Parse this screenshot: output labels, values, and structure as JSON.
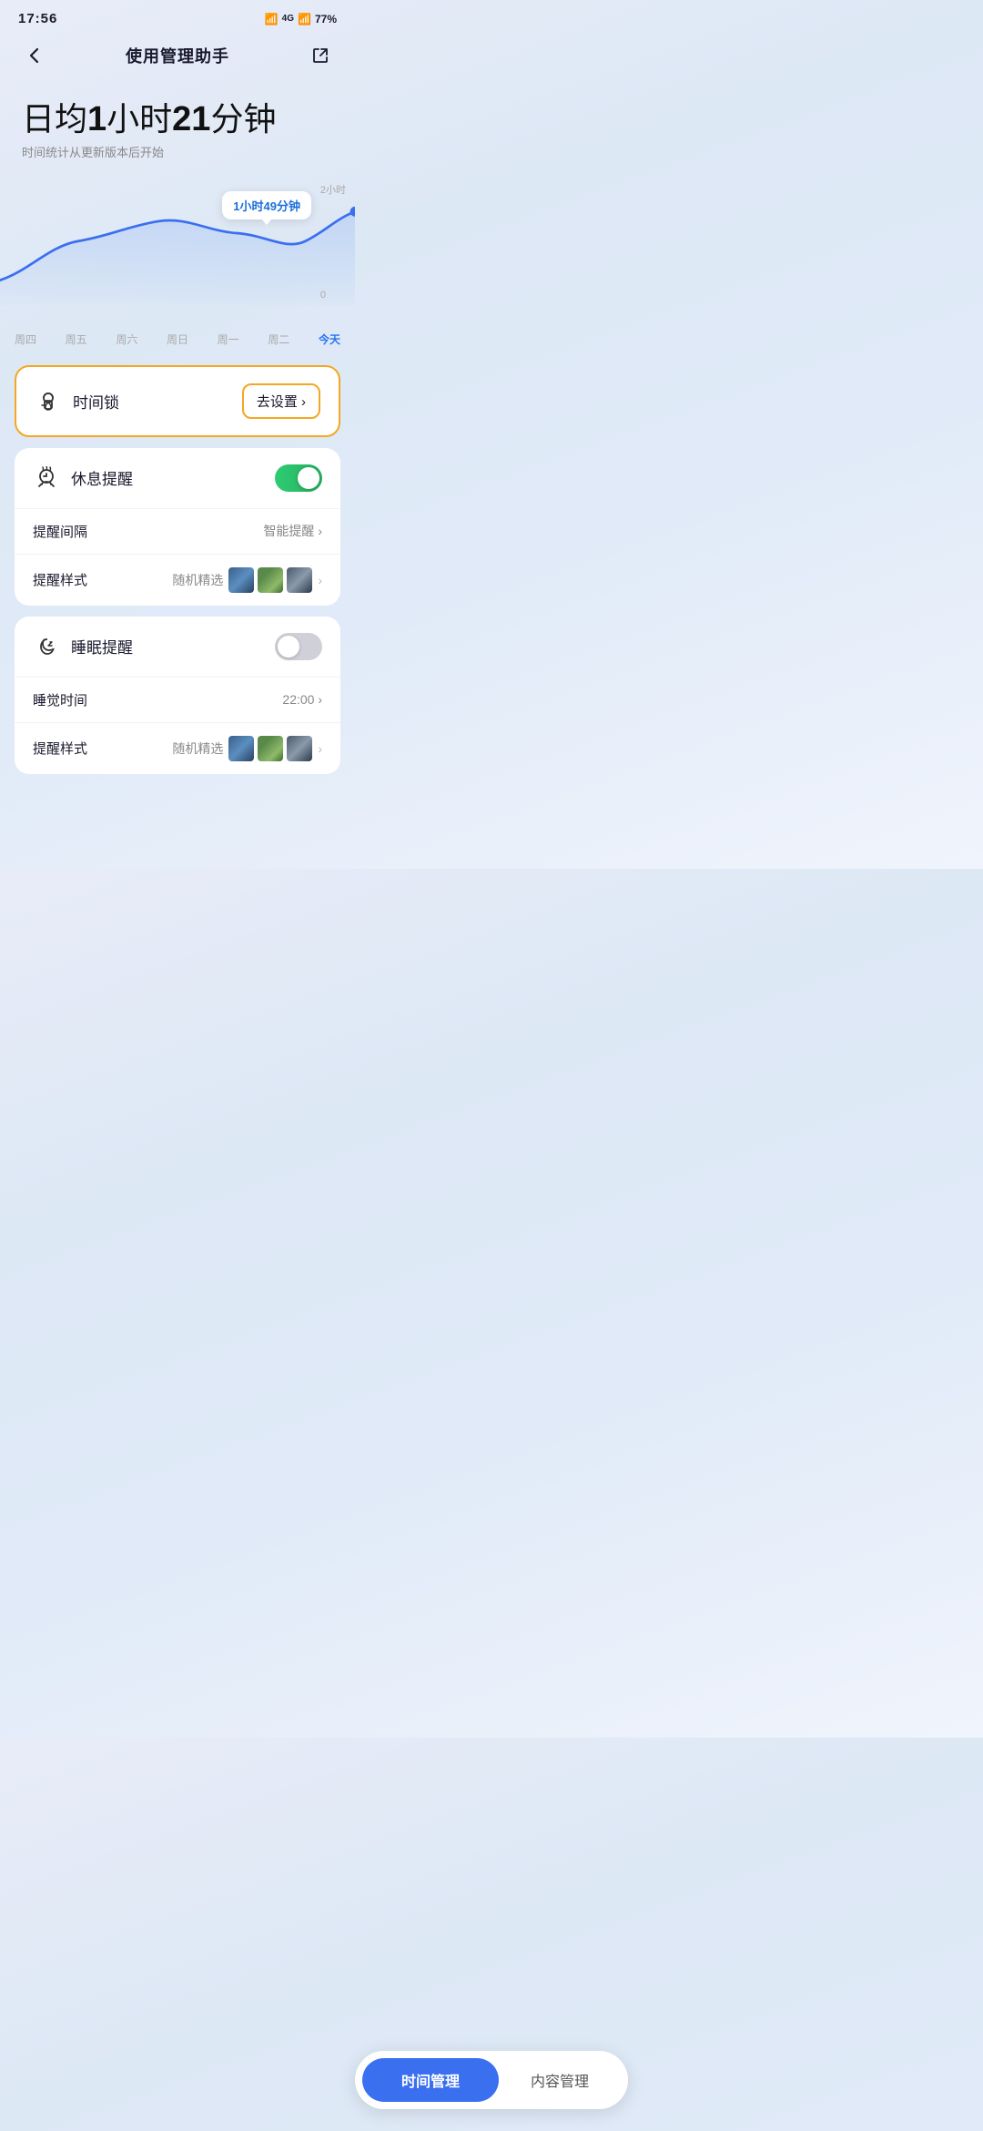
{
  "statusBar": {
    "time": "17:56",
    "battery": "77%"
  },
  "header": {
    "title": "使用管理助手",
    "backLabel": "‹",
    "shareLabel": "↗"
  },
  "dailyAvg": {
    "prefix": "日均",
    "hours": "1",
    "hourUnit": "小时",
    "minutes": "21",
    "minuteUnit": "分钟",
    "subtitle": "时间统计从更新版本后开始"
  },
  "chart": {
    "tooltip": "1小时49分钟",
    "yLabels": [
      "2小时",
      "0"
    ],
    "xLabels": [
      "周四",
      "周五",
      "周六",
      "周日",
      "周一",
      "周二",
      "今天"
    ]
  },
  "timeLock": {
    "label": "时间锁",
    "action": "去设置 ›"
  },
  "restReminder": {
    "label": "休息提醒",
    "toggleOn": true,
    "intervalLabel": "提醒间隔",
    "intervalValue": "智能提醒 ›",
    "styleLabel": "提醒样式",
    "styleValue": "随机精选"
  },
  "sleepReminder": {
    "label": "睡眠提醒",
    "toggleOn": false,
    "sleepTimeLabel": "睡觉时间",
    "sleepTimeValue": "22:00 ›",
    "styleLabel": "提醒样式",
    "styleValue": "随机精选"
  },
  "bottomNav": {
    "timeManagement": "时间管理",
    "contentManagement": "内容管理"
  }
}
